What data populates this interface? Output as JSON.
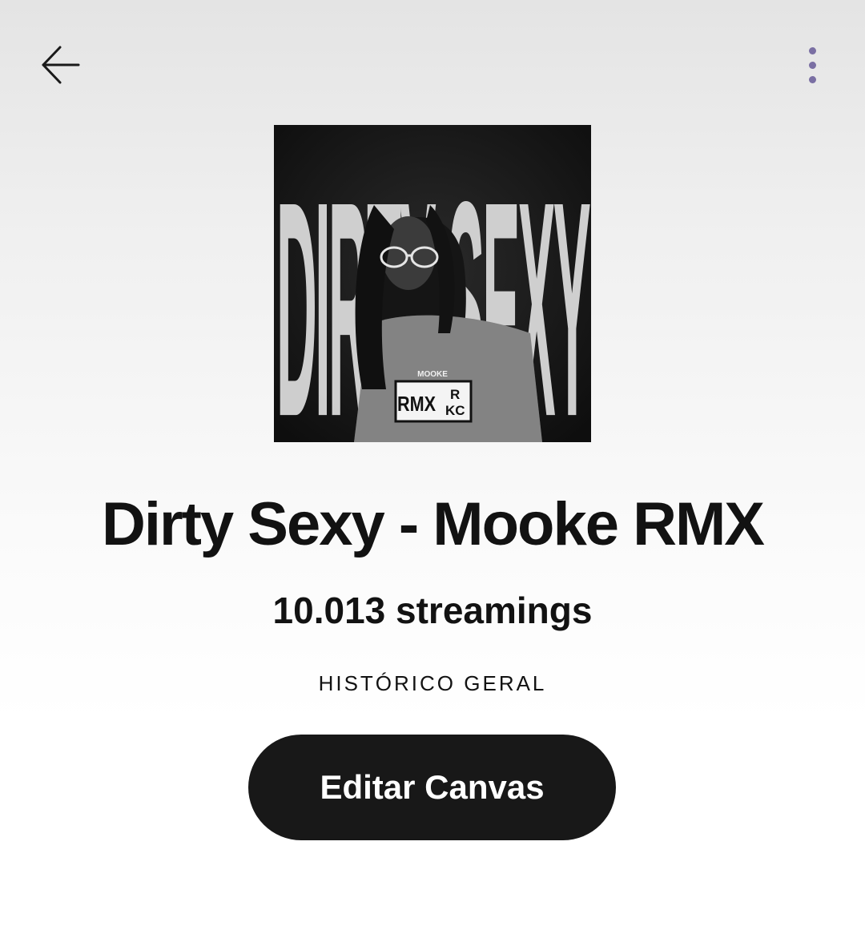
{
  "header": {
    "back_icon": "arrow-left-icon",
    "more_icon": "more-vertical-icon",
    "more_dot_color": "#7a6fa3"
  },
  "track": {
    "cover_art_text": "DIRTY SEXY",
    "cover_shirt_brand": "MOOKE",
    "cover_patch_left": "RMX",
    "cover_patch_right_top": "R",
    "cover_patch_right_bottom": "KC",
    "title": "Dirty Sexy - Mooke RMX",
    "streams": "10.013 streamings",
    "period": "HISTÓRICO GERAL"
  },
  "actions": {
    "edit_canvas_label": "Editar Canvas",
    "button_color": "#181818"
  }
}
